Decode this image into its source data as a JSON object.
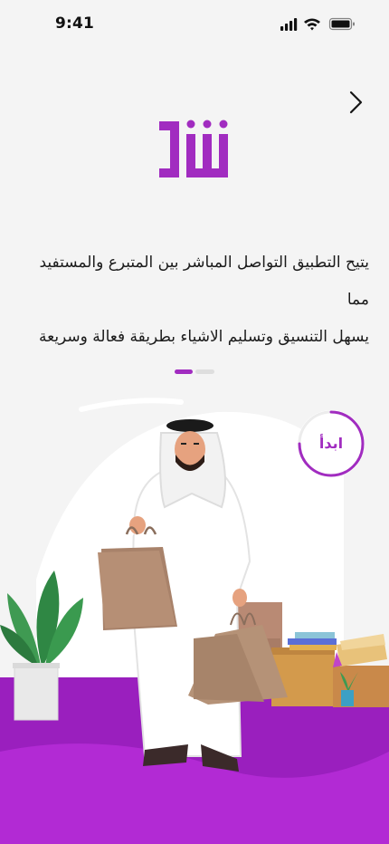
{
  "status_bar": {
    "time": "9:41"
  },
  "onboarding": {
    "description_line1": "يتيح التطبيق التواصل المباشر بين المتبرع والمستفيد مما",
    "description_line2": "يسهل التنسيق وتسليم الاشياء بطريقة فعالة وسريعة",
    "start_label": "ابدأ",
    "page_index": 1,
    "page_count": 2
  },
  "colors": {
    "accent": "#a12cc0",
    "floor": "#9a1fbe",
    "background": "#f4f4f4"
  },
  "icons": {
    "next": "chevron-right-icon",
    "signal": "signal-icon",
    "wifi": "wifi-icon",
    "battery": "battery-icon",
    "logo": "app-logo"
  }
}
